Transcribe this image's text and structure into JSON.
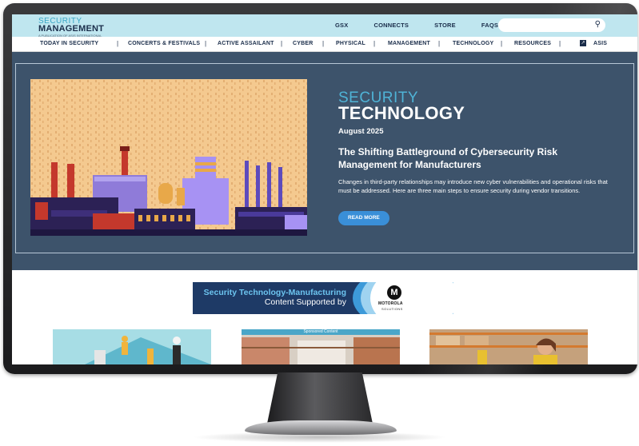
{
  "header": {
    "logo_top": "SECURITY",
    "logo_main": "MANAGEMENT",
    "logo_tag": "A PUBLICATION OF ASIS INTERNATIONAL",
    "top_links": [
      "GSX",
      "CONNECTS",
      "STORE",
      "FAQS"
    ],
    "search_placeholder": "",
    "search_icon": "search-icon"
  },
  "nav": {
    "items": [
      "TODAY IN SECURITY",
      "CONCERTS & FESTIVALS",
      "ACTIVE ASSAILANT",
      "CYBER",
      "PHYSICAL",
      "MANAGEMENT",
      "TECHNOLOGY",
      "RESOURCES",
      "ASIS"
    ],
    "separator": "|",
    "asis_icon": "external-link-icon",
    "asis_icon_glyph": "↗"
  },
  "hero": {
    "brand_small": "SECURITY",
    "brand_big": "TECHNOLOGY",
    "issue_date": "August 2025",
    "headline": "The Shifting Battleground of Cybersecurity Risk Management for Manufacturers",
    "dek": "Changes in third-party relationships may introduce new cyber vulnerabilities and operational risks that must be addressed. Here are three main steps to ensure security during vendor transitions.",
    "read_more_label": "READ MORE"
  },
  "sponsor": {
    "line1": "Security Technology-Manufacturing",
    "line2": "Content Supported by",
    "logo_glyph": "M",
    "brand_name": "MOTOROLA",
    "brand_sub": "SOLUTIONS"
  },
  "cards": {
    "sponsored_label": "Sponsored Content"
  },
  "colors": {
    "topbar": "#bfe6ef",
    "hero_bg": "#3d536b",
    "accent": "#3a8fd8",
    "navy": "#1a2d4a"
  }
}
